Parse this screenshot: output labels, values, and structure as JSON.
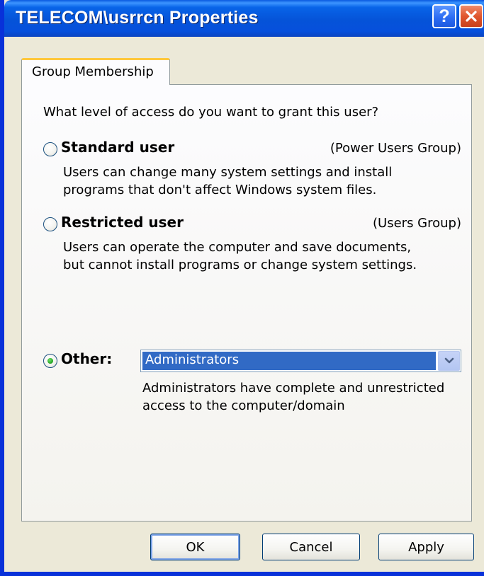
{
  "window": {
    "title": "TELECOM\\usrrcn Properties",
    "help_glyph": "?",
    "colors": {
      "titlebar": "#0553d8",
      "face": "#ece9d8",
      "tab_highlight": "#ffc83c",
      "selection": "#316ac5",
      "radio_selected": "#21a121",
      "close_button": "#e0562e"
    }
  },
  "tabs": [
    {
      "label": "Group Membership",
      "selected": true
    }
  ],
  "panel": {
    "question": "What level of access do you want to grant this user?",
    "options": [
      {
        "label": "Standard user",
        "group": "(Power Users Group)",
        "description": [
          "Users can change many system settings and install",
          "programs that don't affect Windows system files."
        ],
        "selected": false
      },
      {
        "label": "Restricted user",
        "group": "(Users Group)",
        "description": [
          "Users can operate the computer and save documents,",
          "but cannot install programs or change system settings."
        ],
        "selected": false
      },
      {
        "label": "Other:",
        "selected": true,
        "dropdown_value": "Administrators",
        "description": [
          "Administrators have complete and unrestricted",
          "access to the computer/domain"
        ]
      }
    ]
  },
  "buttons": {
    "ok": "OK",
    "cancel": "Cancel",
    "apply": "Apply"
  },
  "icons": {
    "help": "help-icon",
    "close": "close-icon",
    "dropdown": "chevron-down-icon"
  }
}
